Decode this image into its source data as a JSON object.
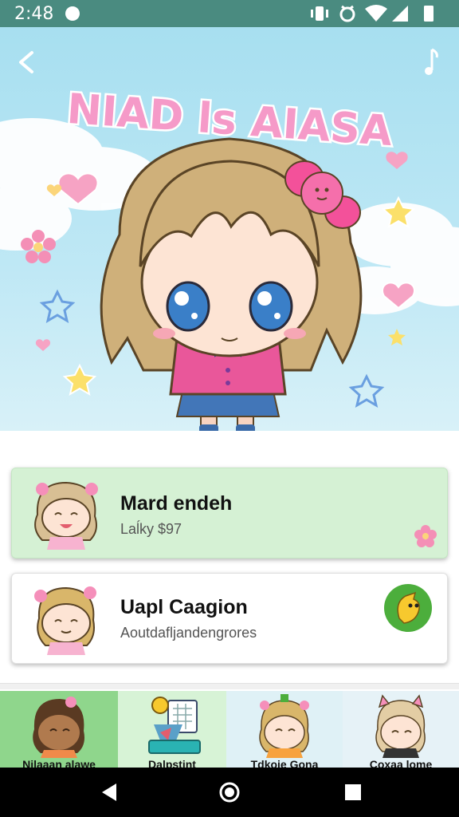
{
  "status_bar": {
    "time": "2:48"
  },
  "hero": {
    "title": "NIAD ls AIASA"
  },
  "cards": [
    {
      "title": "Mard endeh",
      "subtitle": "Laĺky $97"
    },
    {
      "title": "Uapl Caagion",
      "subtitle": "Aoutdafljandengrores"
    }
  ],
  "tabs": [
    {
      "label": "Nilaaan alawe"
    },
    {
      "label": "Dalpstint"
    },
    {
      "label": "Tdkoie Gona"
    },
    {
      "label": "Coxaa lome"
    }
  ],
  "colors": {
    "status_bar": "#4a8b80",
    "card_active": "#d5f1d4",
    "tab_active": "#8fd68c"
  }
}
